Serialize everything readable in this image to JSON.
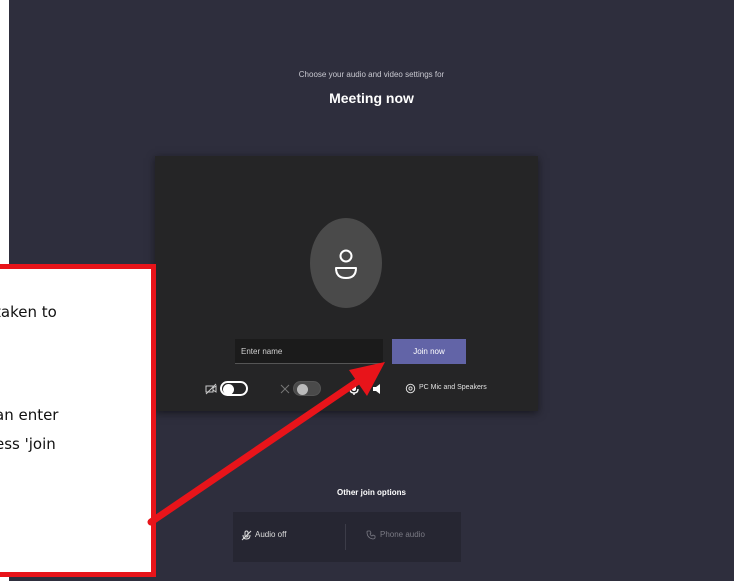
{
  "dialog": {
    "subtitle": "Choose your audio and video settings for",
    "title": "Meeting now",
    "name_placeholder": "Enter name",
    "join_label": "Join now",
    "device_label": "PC Mic and Speakers"
  },
  "other_options": {
    "heading": "Other join options",
    "audio_off": "Audio off",
    "phone_audio": "Phone audio"
  },
  "callout": {
    "lines": [
      "taken to",
      "an enter",
      "ess 'join"
    ]
  },
  "colors": {
    "app_background": "#2e2e3d",
    "preview_background": "#252526",
    "accent": "#6264a7",
    "callout_border": "#e8141a"
  },
  "icons": [
    "person-icon",
    "camera-off-icon",
    "blur-icon",
    "settings-icon",
    "speaker-icon",
    "mic-off-icon",
    "phone-icon"
  ]
}
